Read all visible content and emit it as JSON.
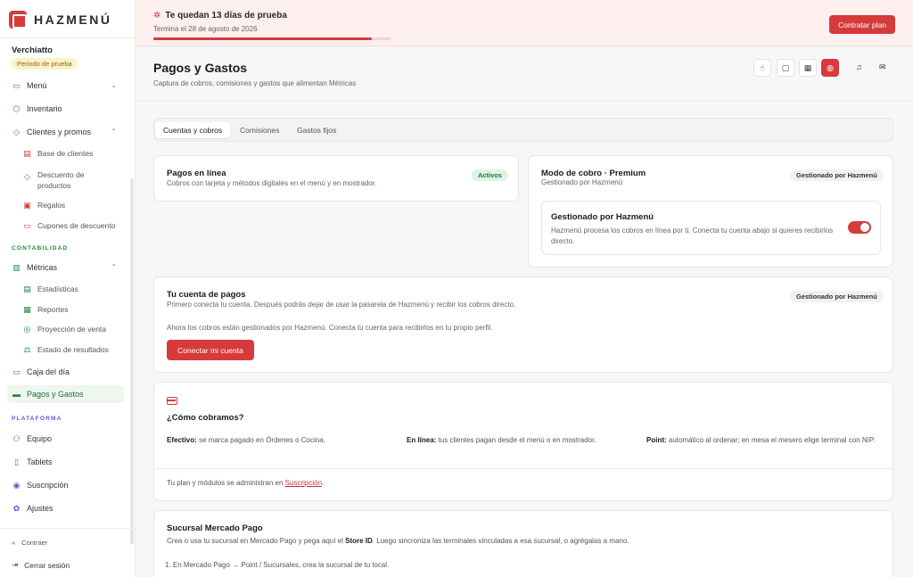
{
  "brand": {
    "name": "HAZMENÚ",
    "accent": "#d63a3a"
  },
  "sidebar": {
    "business_name": "Verchiatto",
    "trial_badge": "Periodo de prueba",
    "items": {
      "menu": "Menú",
      "inventario": "Inventario",
      "clientes": "Clientes y promos",
      "base_clientes": "Base de clientes",
      "descuento": "Descuento de productos",
      "regalos": "Regalos",
      "cupones": "Cupones de descuento",
      "metricas": "Métricas",
      "estadisticas": "Estadísticas",
      "reportes": "Reportes",
      "proyeccion": "Proyección de venta",
      "estado": "Estado de resultados",
      "caja": "Caja del día",
      "pagos": "Pagos y Gastos",
      "equipo": "Equipo",
      "tablets": "Tablets",
      "suscripcion": "Suscripción",
      "ajustes": "Ajustes"
    },
    "sections": {
      "contabilidad": "CONTABILIDAD",
      "plataforma": "PLATAFORMA"
    },
    "contraer": "Contraer",
    "cerrar_sesion": "Cerrar sesión"
  },
  "banner": {
    "title": "Te quedan 13 días de prueba",
    "subtitle": "Termina el 28 de agosto de 2026",
    "progress": 0.92,
    "cta": "Contratar plan"
  },
  "page": {
    "title": "Pagos y Gastos",
    "subtitle": "Captura de cobros, comisiones y gastos que alimentan Métricas"
  },
  "tabs": [
    "Cuentas y cobros",
    "Comisiones",
    "Gastos fijos"
  ],
  "online_payments": {
    "title": "Pagos en línea",
    "subtitle": "Cobros con tarjeta y métodos digitales en el menú y en mostrador.",
    "badge": "Activos"
  },
  "mode": {
    "title": "Modo de cobro · Premium",
    "subtitle": "Gestionado por Hazmenú",
    "badge": "Gestionado por Hazmenú",
    "inner_title": "Gestionado por Hazmenú",
    "inner_text": "Hazmenú procesa los cobros en línea por ti. Conecta tu cuenta abajo si quieres recibirlos directo.",
    "toggle_on": true
  },
  "account": {
    "title": "Tu cuenta de pagos",
    "subtitle": "Primero conecta tu cuenta. Después podrás dejar de usar la pasarela de Hazmenú y recibir los cobros directo.",
    "badge": "Gestionado por Hazmenú",
    "note": "Ahora los cobros están gestionados por Hazmenú. Conecta tu cuenta para recibirlos en tu propio perfil.",
    "button": "Conectar mi cuenta"
  },
  "how": {
    "title": "¿Cómo cobramos?",
    "efectivo_label": "Efectivo:",
    "efectivo_text": " se marca pagado en Órdenes o Cocina.",
    "linea_label": "En línea:",
    "linea_text": " tus clientes pagan desde el menú o en mostrador.",
    "point_label": "Point:",
    "point_text": " automático al ordenar; en mesa el mesero elige terminal con NIP.",
    "footer_prefix": "Tu plan y módulos se administran en ",
    "footer_link": "Suscripción",
    "footer_suffix": "."
  },
  "mercado": {
    "title": "Sucursal Mercado Pago",
    "subtitle_a": "Crea o usa tu sucursal en Mercado Pago y pega aquí el ",
    "subtitle_b": "Store ID",
    "subtitle_c": ". Luego sincroniza las terminales vinculadas a esa sucursal, o agrégalas a mano.",
    "step1": "1.  En Mercado Pago → Point / Sucursales, crea la sucursal de tu local."
  }
}
